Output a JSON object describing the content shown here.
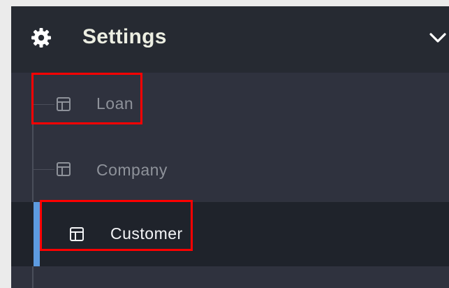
{
  "header": {
    "title": "Settings",
    "icon": "gear-icon",
    "toggle_icon": "chevron-down-icon"
  },
  "menu": {
    "items": [
      {
        "label": "Loan",
        "icon": "table-layout-icon",
        "active": false,
        "highlighted": true
      },
      {
        "label": "Company",
        "icon": "table-layout-icon",
        "active": false,
        "highlighted": false
      },
      {
        "label": "Customer",
        "icon": "table-layout-icon",
        "active": true,
        "highlighted": true
      }
    ]
  },
  "colors": {
    "panel_bg": "#2f323e",
    "header_bg": "#262a32",
    "active_bg": "#1f232b",
    "active_indicator": "#5d9be0",
    "highlight_border": "#ff0000",
    "title_text": "#eceee2",
    "muted_text": "#8e929a"
  }
}
